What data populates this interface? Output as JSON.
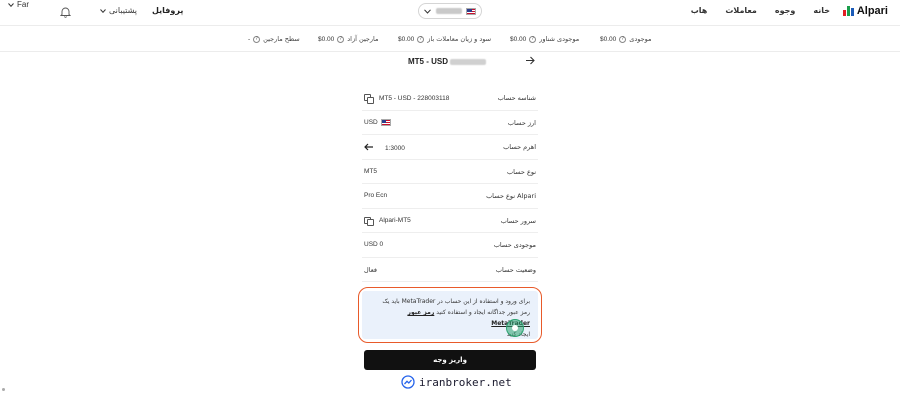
{
  "nav": {
    "logo_text": "Alpari",
    "links": [
      "خانه",
      "وجوه",
      "معاملات",
      "هاب"
    ],
    "profile": "پروفایل",
    "support": "پشتیبانی",
    "language": "Far"
  },
  "stats": {
    "balance_label": "موجودی",
    "balance_value": "$0.00",
    "floating_balance_label": "موجودی شناور",
    "floating_balance_value": "$0.00",
    "open_pl_label": "سود و زیان معاملات باز",
    "open_pl_value": "$0.00",
    "free_margin_label": "مارجین آزاد",
    "free_margin_value": "$0.00",
    "margin_level_label": "سطح مارجین",
    "margin_level_value": "-"
  },
  "panel": {
    "title": "MT5 - USD",
    "rows": [
      {
        "label": "شناسه حساب",
        "value": "MT5 - USD - 228003118"
      },
      {
        "label": "ارز حساب",
        "value": "USD"
      },
      {
        "label": "اهرم حساب",
        "value": "1:3000"
      },
      {
        "label": "نوع حساب",
        "value": "MT5"
      },
      {
        "label": "نوع حساب Alpari",
        "value": "Pro Ecn"
      },
      {
        "label": "سرور حساب",
        "value": "Alpari-MT5"
      },
      {
        "label": "موجودی حساب",
        "value": "USD 0"
      },
      {
        "label": "وضعیت حساب",
        "value": "فعال"
      }
    ],
    "info_line1": "برای ورود و استفاده از این حساب در MetaTrader باید یک",
    "info_line2_start": "رمز عبور جداگانه ایجاد و استفاده کنید",
    "info_link_text": "رمز عبور MetaTrader",
    "info_line3": "ایجاد کنید",
    "deposit_button": "واریز وجه"
  },
  "watermark": "iranbroker.net",
  "colors": {
    "accent_orange": "#e85a2a",
    "cursor_green": "#2ba371",
    "info_bg": "#eaf1fb",
    "button_black": "#111111"
  }
}
